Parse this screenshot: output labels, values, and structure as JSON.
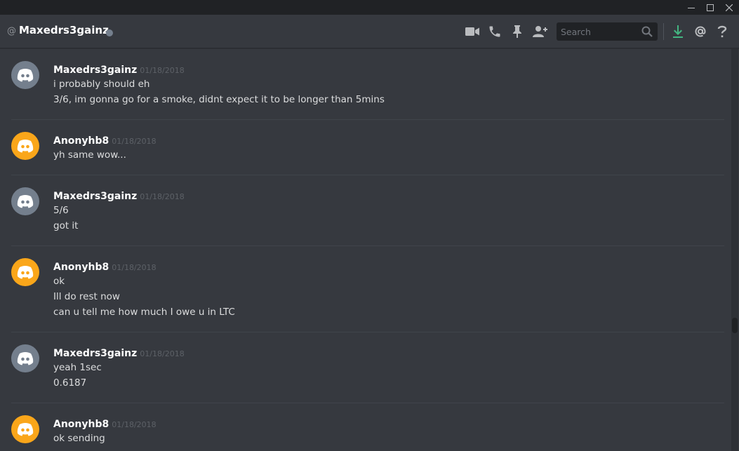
{
  "window": {
    "controls": [
      "minimize",
      "maximize",
      "close"
    ]
  },
  "header": {
    "at_symbol": "@",
    "channel_name": "Maxedrs3gainz",
    "status_color": "#747f8d",
    "icons": [
      "video-icon",
      "phone-icon",
      "pin-icon",
      "add-user-icon",
      "download-icon",
      "mention-icon",
      "help-icon"
    ],
    "search": {
      "placeholder": "Search",
      "value": ""
    }
  },
  "colors": {
    "background": "#36393f",
    "titlebar": "#202225",
    "avatar_grey": "#747f8d",
    "avatar_orange": "#faa61a",
    "download_accent": "#43b581"
  },
  "messages": [
    {
      "author": "Maxedrs3gainz",
      "timestamp": "01/18/2018",
      "avatar_color": "#747f8d",
      "lines": [
        "i probably should eh",
        "3/6, im gonna go for a smoke, didnt expect it to be longer than 5mins"
      ]
    },
    {
      "author": "Anonyhb8",
      "timestamp": "01/18/2018",
      "avatar_color": "#faa61a",
      "lines": [
        "yh same wow..."
      ]
    },
    {
      "author": "Maxedrs3gainz",
      "timestamp": "01/18/2018",
      "avatar_color": "#747f8d",
      "lines": [
        "5/6",
        "got it"
      ]
    },
    {
      "author": "Anonyhb8",
      "timestamp": "01/18/2018",
      "avatar_color": "#faa61a",
      "lines": [
        "ok",
        "Ill do rest now",
        "can u tell me how much I owe u in LTC"
      ]
    },
    {
      "author": "Maxedrs3gainz",
      "timestamp": "01/18/2018",
      "avatar_color": "#747f8d",
      "lines": [
        "yeah 1sec",
        "0.6187"
      ]
    },
    {
      "author": "Anonyhb8",
      "timestamp": "01/18/2018",
      "avatar_color": "#faa61a",
      "lines": [
        "ok sending"
      ]
    }
  ]
}
